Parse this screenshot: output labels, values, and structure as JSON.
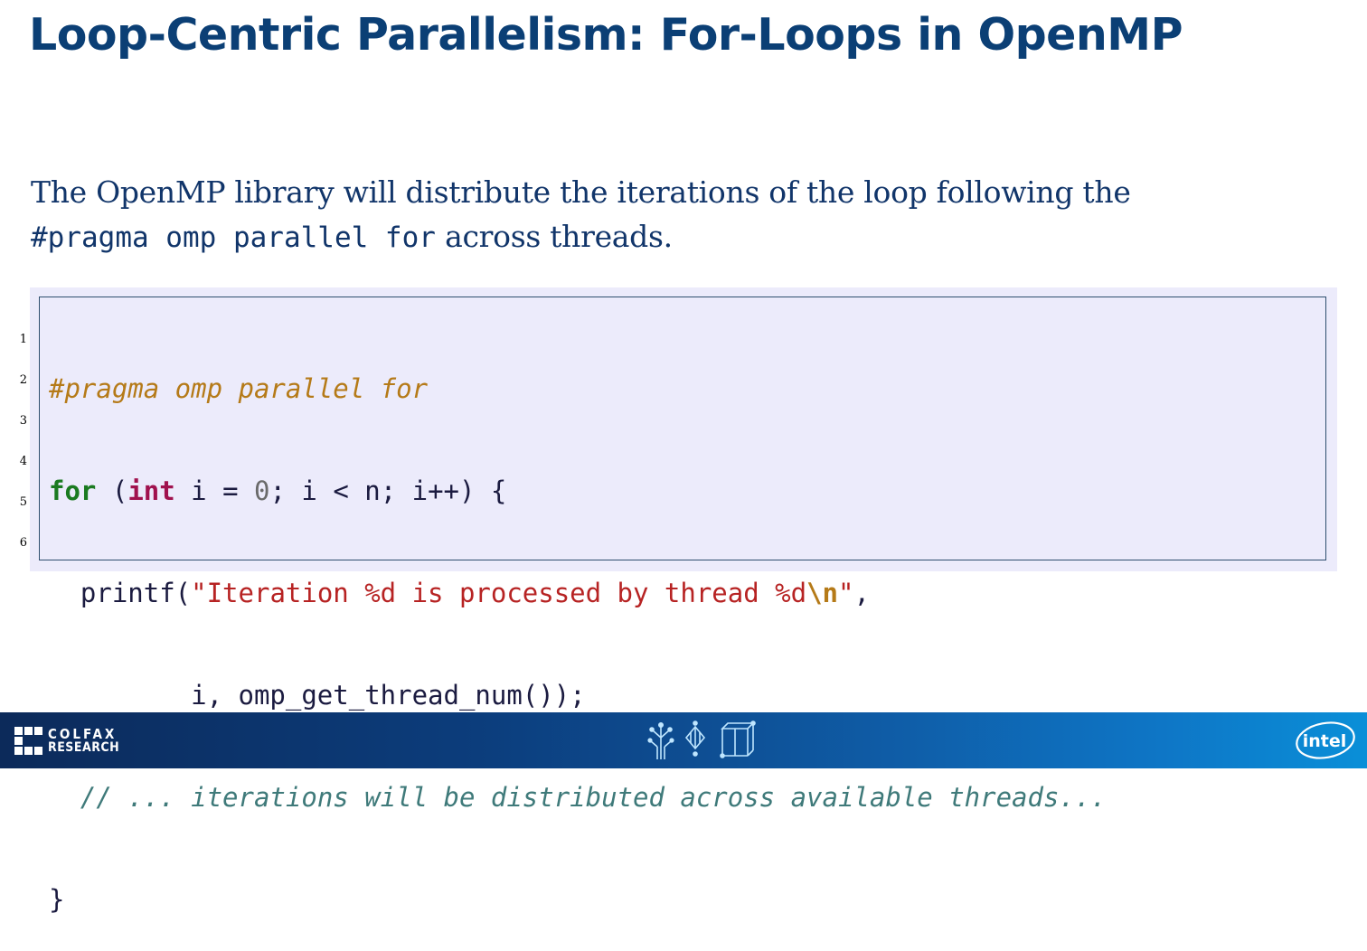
{
  "slide": {
    "title": "Loop-Centric Parallelism: For-Loops in OpenMP"
  },
  "body": {
    "line1": "The OpenMP library will distribute the iterations of the loop following the",
    "code_inline": "#pragma omp parallel for",
    "line2_rest": " across threads."
  },
  "code": {
    "line_numbers": [
      "1",
      "2",
      "3",
      "4",
      "5",
      "6"
    ],
    "l1_pragma": "#pragma omp parallel for",
    "l2_for": "for",
    "l2_open": " (",
    "l2_int": "int",
    "l2_mid": " i = ",
    "l2_zero": "0",
    "l2_rest": "; i < n; i++) {",
    "l3_indent": "  printf(",
    "l3_str1": "\"Iteration %d is processed by thread %d",
    "l3_esc": "\\n",
    "l3_str2": "\"",
    "l3_end": ",",
    "l4": "         i, omp_get_thread_num());",
    "l5_indent": "  ",
    "l5_comment": "// ... iterations will be distributed across available threads...",
    "l6": "}"
  },
  "footer": {
    "brand_line1": "COLFAX",
    "brand_line2": "RESEARCH",
    "partner_logo": "intel"
  },
  "colors": {
    "title": "#0b3f75",
    "body_text": "#11356a",
    "code_background": "#ecebfb",
    "keyword": "#1a7a20",
    "type": "#a0124e",
    "string": "#b72323",
    "preprocessor": "#b57a18",
    "comment": "#3f7a7a",
    "footer_start": "#0c2a5a",
    "footer_end": "#0a8fd8"
  },
  "icons": [
    "colfax-logo-icon",
    "tree-icon",
    "diamond-icon",
    "cube-icon",
    "intel-logo-icon"
  ]
}
